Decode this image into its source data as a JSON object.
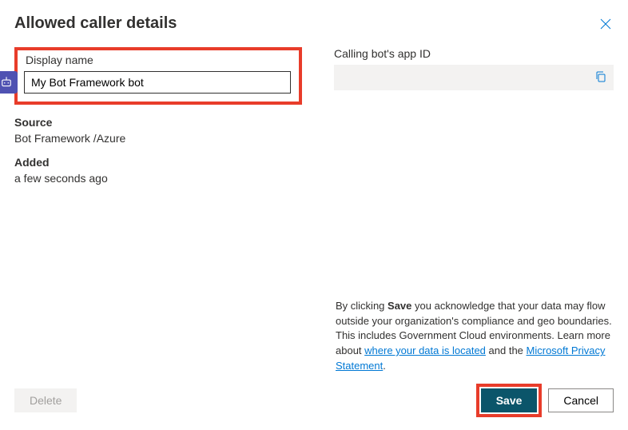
{
  "header": {
    "title": "Allowed caller details"
  },
  "left": {
    "display_name_label": "Display name",
    "display_name_value": "My Bot Framework bot",
    "source_label": "Source",
    "source_value": "Bot Framework /Azure",
    "added_label": "Added",
    "added_value": "a few seconds ago"
  },
  "right": {
    "app_id_label": "Calling bot's app ID",
    "app_id_value": ""
  },
  "disclaimer": {
    "prefix": "By clicking ",
    "bold": "Save",
    "mid1": " you acknowledge that your data may flow outside your organization's compliance and geo boundaries. This includes Government Cloud environments. Learn more about ",
    "link1": "where your data is located",
    "mid2": " and the ",
    "link2": "Microsoft Privacy Statement",
    "suffix": "."
  },
  "buttons": {
    "delete": "Delete",
    "save": "Save",
    "cancel": "Cancel"
  }
}
